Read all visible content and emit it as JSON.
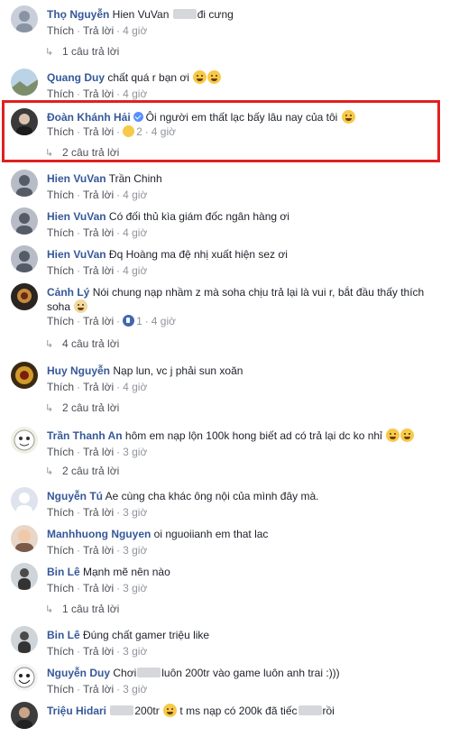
{
  "highlight_color": "#e02020",
  "name_color": "#365899",
  "actions": {
    "like": "Thích",
    "reply": "Trả lời"
  },
  "comments": [
    {
      "name": "Thọ Nguyễn",
      "pre": "Hien VuVan",
      "post": "đi cưng",
      "time": "4 giờ",
      "replies": "1 câu trả lời",
      "avatar": "person-icon"
    },
    {
      "name": "Quang Duy",
      "pre": "chất quá r bạn ơi",
      "post": "",
      "time": "4 giờ",
      "replies": "",
      "avatar": "landscape-icon"
    },
    {
      "name": "Đoàn Khánh Hải",
      "pre": "Ôi người em thất lạc bấy lâu nay của tôi",
      "post": "",
      "time": "4 giờ",
      "reactions": "2",
      "replies": "2 câu trả lời",
      "avatar": "person-dark-icon"
    },
    {
      "name": "Hien VuVan",
      "pre": "Trần Chinh",
      "post": "",
      "time": "4 giờ",
      "replies": "",
      "avatar": "person-icon"
    },
    {
      "name": "Hien VuVan",
      "pre": "Có đối thủ kìa giám đốc ngân hàng ơi",
      "post": "",
      "time": "4 giờ",
      "replies": "",
      "avatar": "person-icon"
    },
    {
      "name": "Hien VuVan",
      "pre": "Đq Hoàng",
      "post": "ma đệ nhị xuất hiện sez ơi",
      "time": "4 giờ",
      "replies": "",
      "avatar": "person-icon"
    },
    {
      "name": "Cảnh Lý",
      "pre": "Nói chung nạp nhầm z mà soha chịu trả lại là vui r, bắt đầu thấy thích soha",
      "post": "",
      "time": "4 giờ",
      "reactions": "1",
      "replies": "4 câu trả lời",
      "avatar": "game-avatar-icon"
    },
    {
      "name": "Huy Nguyễn",
      "pre": "Nạp lun, vc j phải sun xoăn",
      "post": "",
      "time": "4 giờ",
      "replies": "2 câu trả lời",
      "avatar": "game-avatar-icon"
    },
    {
      "name": "Trần Thanh An",
      "pre": "hôm em nạp lộn 100k hong biết ad có trả lại dc ko nhỉ",
      "post": "",
      "time": "3 giờ",
      "replies": "2 câu trả lời",
      "avatar": "cartoon-icon"
    },
    {
      "name": "Nguyễn Tú",
      "pre": "Ae cùng cha khác ông nội của mình đây mà.",
      "post": "",
      "time": "3 giờ",
      "replies": "",
      "avatar": "default-avatar-icon"
    },
    {
      "name": "Manhhuong Nguyen",
      "pre": "oi nguoiianh em that lac",
      "post": "",
      "time": "3 giờ",
      "replies": "",
      "avatar": "person-icon"
    },
    {
      "name": "Bin Lê",
      "pre": "Mạnh mẽ nên nào",
      "post": "",
      "time": "3 giờ",
      "replies": "1 câu trả lời",
      "avatar": "person-icon"
    },
    {
      "name": "Bin Lê",
      "pre": "Đúng chất gamer triệu like",
      "post": "",
      "time": "3 giờ",
      "replies": "",
      "avatar": "person-icon"
    },
    {
      "name": "Nguyễn Duy",
      "pre": "Chơi",
      "post": "luôn 200tr vào game luôn anh trai :)))",
      "time": "3 giờ",
      "replies": "",
      "avatar": "cartoon-icon"
    },
    {
      "name": "Triệu Hidari",
      "pre": "200tr",
      "post": "t ms nạp có 200k đã tiếc",
      "tail": "rồi",
      "time": "",
      "replies": "",
      "avatar": "person-dark-icon"
    }
  ]
}
